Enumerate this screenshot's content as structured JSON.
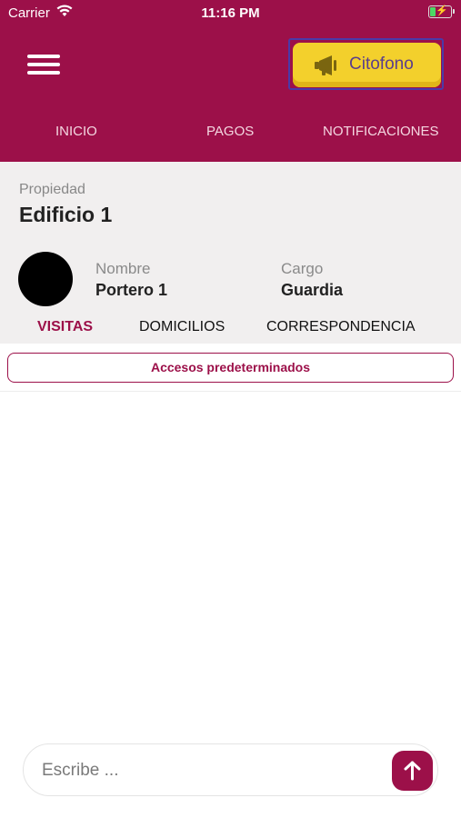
{
  "status_bar": {
    "carrier": "Carrier",
    "time": "11:16 PM"
  },
  "header": {
    "citofono_label": "Citofono",
    "nav": [
      "INICIO",
      "PAGOS",
      "NOTIFICACIONES"
    ]
  },
  "property": {
    "label": "Propiedad",
    "value": "Edificio 1"
  },
  "user": {
    "name_label": "Nombre",
    "name": "Portero 1",
    "role_label": "Cargo",
    "role": "Guardia"
  },
  "subtabs": [
    "VISITAS",
    "DOMICILIOS",
    "CORRESPONDENCIA"
  ],
  "active_subtab": "VISITAS",
  "accesos_label": "Accesos predeterminados",
  "composer": {
    "placeholder": "Escribe ..."
  },
  "colors": {
    "brand": "#9c1049",
    "accent": "#f3d02c"
  },
  "icons": [
    "wifi-icon",
    "battery-icon",
    "menu-icon",
    "megaphone-icon",
    "send-arrow-icon"
  ]
}
